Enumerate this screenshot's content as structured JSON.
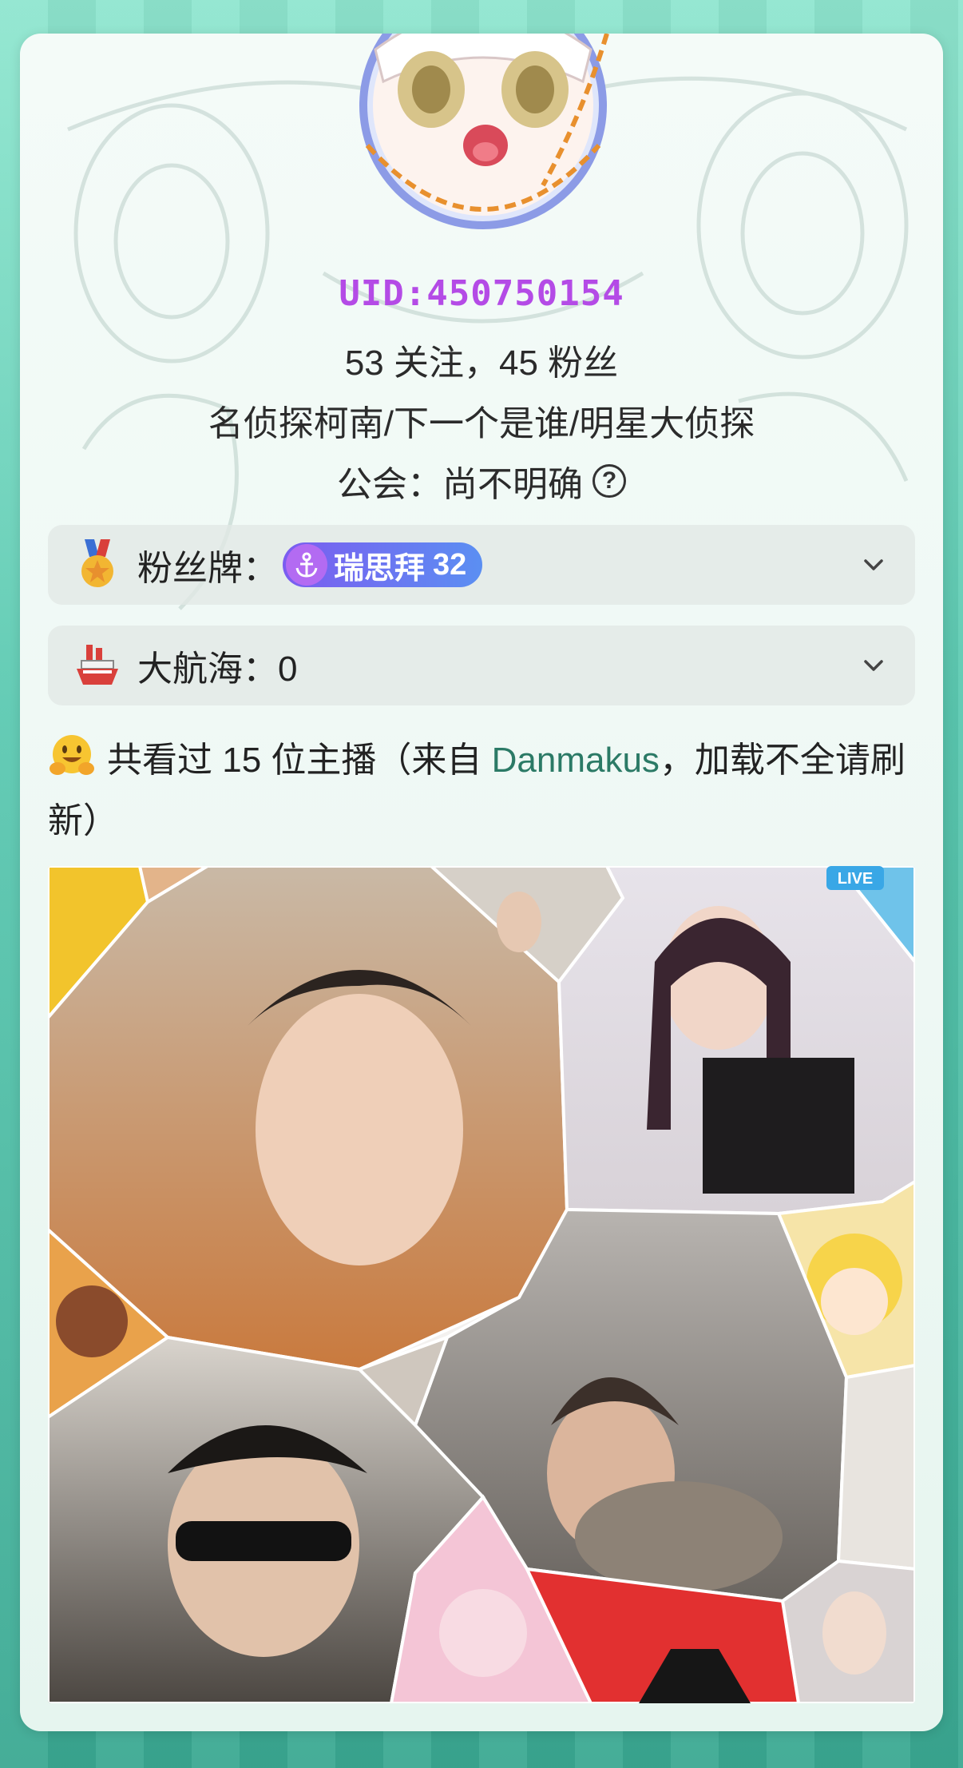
{
  "profile": {
    "uid": "UID:450750154",
    "follow_stats": "53 关注，45 粉丝",
    "tags": "名侦探柯南/下一个是谁/明星大侦探",
    "guild": "公会：尚不明确"
  },
  "fan_medal": {
    "label": "粉丝牌：",
    "badge_name": "瑞思拜",
    "badge_level": "32",
    "icon": "medal-icon"
  },
  "guard": {
    "label": "大航海：0",
    "icon": "ship-icon"
  },
  "watched": {
    "prefix": "共看过 15 位主播（来自 ",
    "link": "Danmakus",
    "suffix": "，加载不全请刷新）",
    "icon": "hugging-face-icon"
  },
  "mosaic": {
    "live_badge": "LIVE",
    "cell_count": 15
  },
  "colors": {
    "uid": "#b44be6",
    "link": "#2b7a66",
    "badge_start": "#7b5cf0",
    "badge_end": "#5b8ff2"
  }
}
